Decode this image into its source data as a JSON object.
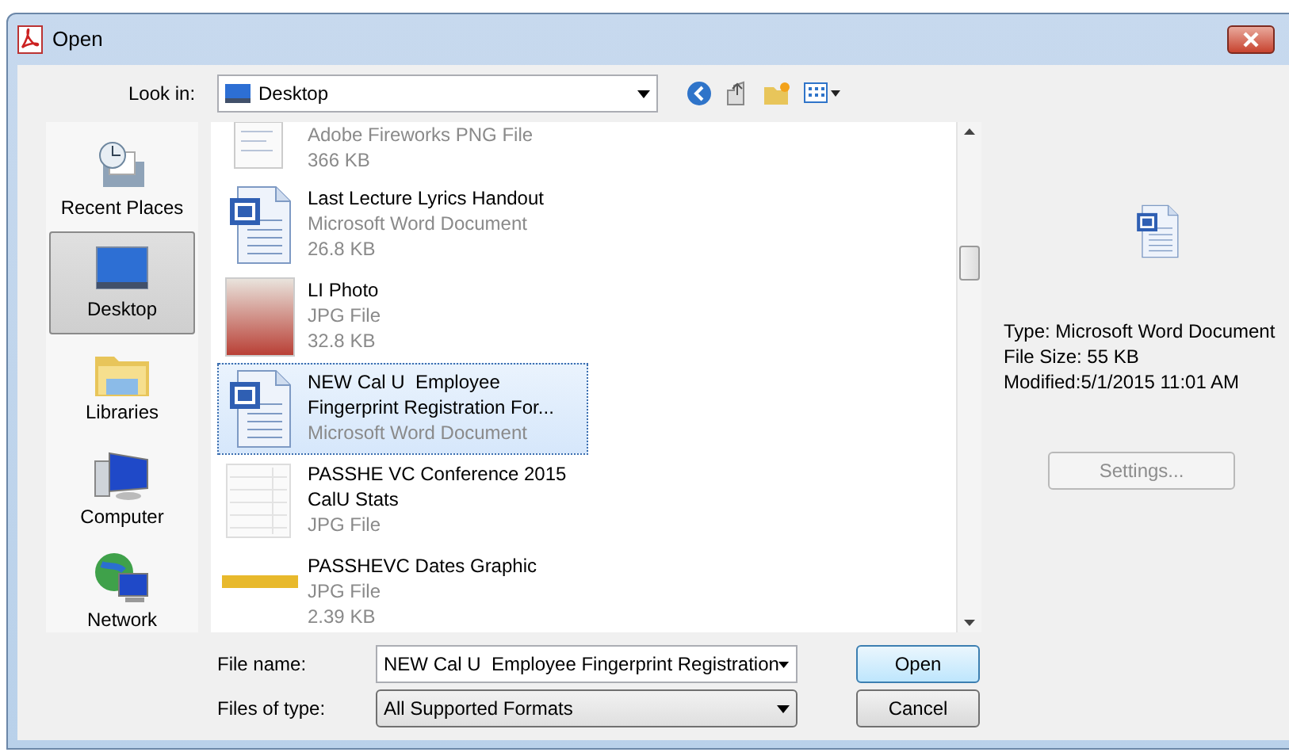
{
  "window": {
    "title": "Open"
  },
  "look_in": {
    "label": "Look in:",
    "value": "Desktop"
  },
  "places": [
    {
      "label": "Recent Places",
      "kind": "recent",
      "selected": false
    },
    {
      "label": "Desktop",
      "kind": "desktop",
      "selected": true
    },
    {
      "label": "Libraries",
      "kind": "libraries",
      "selected": false
    },
    {
      "label": "Computer",
      "kind": "computer",
      "selected": false
    },
    {
      "label": "Network",
      "kind": "network",
      "selected": false
    }
  ],
  "files": [
    {
      "kind": "png",
      "type": "Adobe Fireworks PNG File",
      "size": "366 KB",
      "selected": false
    },
    {
      "kind": "word",
      "name_lines": [
        "Last Lecture Lyrics Handout"
      ],
      "type": "Microsoft Word Document",
      "size": "26.8 KB",
      "selected": false
    },
    {
      "kind": "photo",
      "name_lines": [
        "LI Photo"
      ],
      "type": "JPG File",
      "size": "32.8 KB",
      "selected": false
    },
    {
      "kind": "word",
      "name_lines": [
        "NEW Cal U  Employee",
        "Fingerprint Registration For..."
      ],
      "type": "Microsoft Word Document",
      "selected": true
    },
    {
      "kind": "sheet",
      "name_lines": [
        "PASSHE VC Conference 2015",
        "CalU Stats"
      ],
      "type": "JPG File",
      "selected": false
    },
    {
      "kind": "banner",
      "name_lines": [
        "PASSHEVC Dates Graphic"
      ],
      "type": "JPG File",
      "size": "2.39 KB",
      "selected": false
    }
  ],
  "preview": {
    "details": [
      "Type: Microsoft Word Document",
      "File Size: 55 KB",
      "Modified:5/1/2015 11:01 AM"
    ],
    "settings_button": "Settings..."
  },
  "file_name": {
    "label": "File name:",
    "value": "NEW Cal U  Employee Fingerprint Registration"
  },
  "file_type": {
    "label": "Files of type:",
    "value": "All Supported Formats"
  },
  "buttons": [
    {
      "label": "Open",
      "default": true
    },
    {
      "label": "Cancel",
      "default": false
    }
  ]
}
